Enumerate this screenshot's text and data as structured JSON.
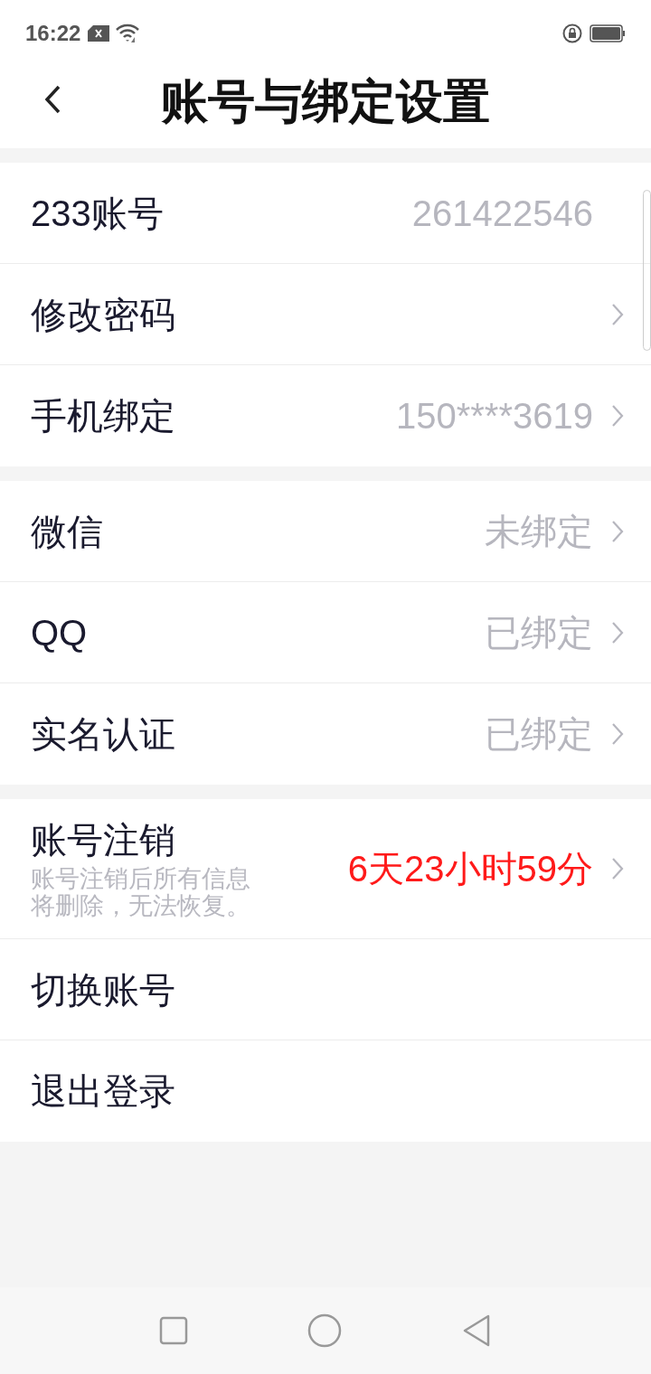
{
  "status_bar": {
    "time": "16:22"
  },
  "header": {
    "title": "账号与绑定设置"
  },
  "groups": [
    {
      "rows": [
        {
          "label": "233账号",
          "value": "261422546",
          "chevron": false
        },
        {
          "label": "修改密码",
          "chevron": true
        },
        {
          "label": "手机绑定",
          "value": "150****3619",
          "chevron": true
        }
      ]
    },
    {
      "rows": [
        {
          "label": "微信",
          "value": "未绑定",
          "chevron": true
        },
        {
          "label": "QQ",
          "value": "已绑定",
          "chevron": true
        },
        {
          "label": "实名认证",
          "value": "已绑定",
          "chevron": true
        }
      ]
    },
    {
      "rows": [
        {
          "label": "账号注销",
          "subtitle": "账号注销后所有信息将删除，无法恢复。",
          "value": "6天23小时59分",
          "chevron": true,
          "alert": true
        },
        {
          "label": "切换账号",
          "chevron": false
        },
        {
          "label": "退出登录",
          "chevron": false
        }
      ]
    }
  ]
}
